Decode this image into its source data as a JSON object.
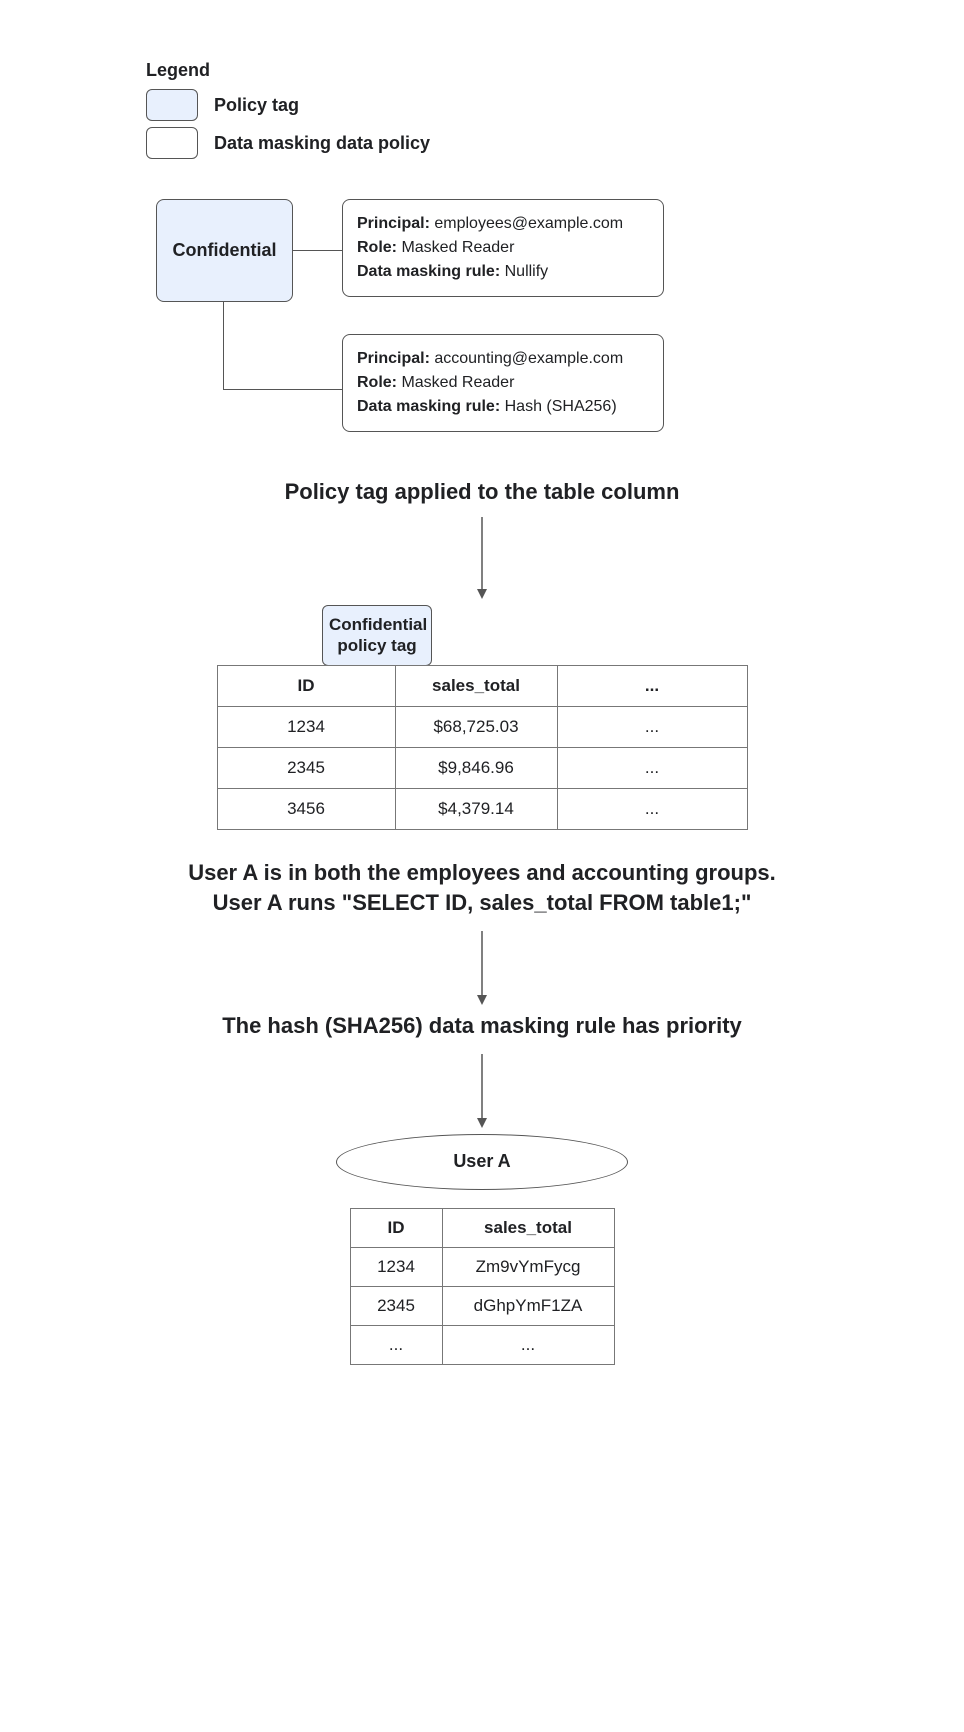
{
  "legend": {
    "title": "Legend",
    "tag_label": "Policy tag",
    "policy_label": "Data masking data policy"
  },
  "confidential_label": "Confidential",
  "policy1": {
    "principal_label": "Principal:",
    "principal_value": "employees@example.com",
    "role_label": "Role:",
    "role_value": "Masked Reader",
    "rule_label": "Data masking rule:",
    "rule_value": "Nullify"
  },
  "policy2": {
    "principal_label": "Principal:",
    "principal_value": "accounting@example.com",
    "role_label": "Role:",
    "role_value": "Masked Reader",
    "rule_label": "Data masking rule:",
    "rule_value": "Hash (SHA256)"
  },
  "section_title": "Policy tag applied to the table column",
  "badge_line1": "Confidential",
  "badge_line2": "policy tag",
  "table1": {
    "h_id": "ID",
    "h_st": "sales_total",
    "h_el": "...",
    "r1_id": "1234",
    "r1_st": "$68,725.03",
    "r1_el": "...",
    "r2_id": "2345",
    "r2_st": "$9,846.96",
    "r2_el": "...",
    "r3_id": "3456",
    "r3_st": "$4,379.14",
    "r3_el": "..."
  },
  "caption_user_line1": "User A is in both the employees and accounting groups.",
  "caption_user_line2": "User A runs \"SELECT ID, sales_total FROM table1;\"",
  "caption_priority": "The hash (SHA256) data masking rule has priority",
  "user_oval": "User A",
  "table2": {
    "h_id": "ID",
    "h_st": "sales_total",
    "r1_id": "1234",
    "r1_st": "Zm9vYmFycg",
    "r2_id": "2345",
    "r2_st": "dGhpYmF1ZA",
    "r3_id": "...",
    "r3_st": "..."
  }
}
